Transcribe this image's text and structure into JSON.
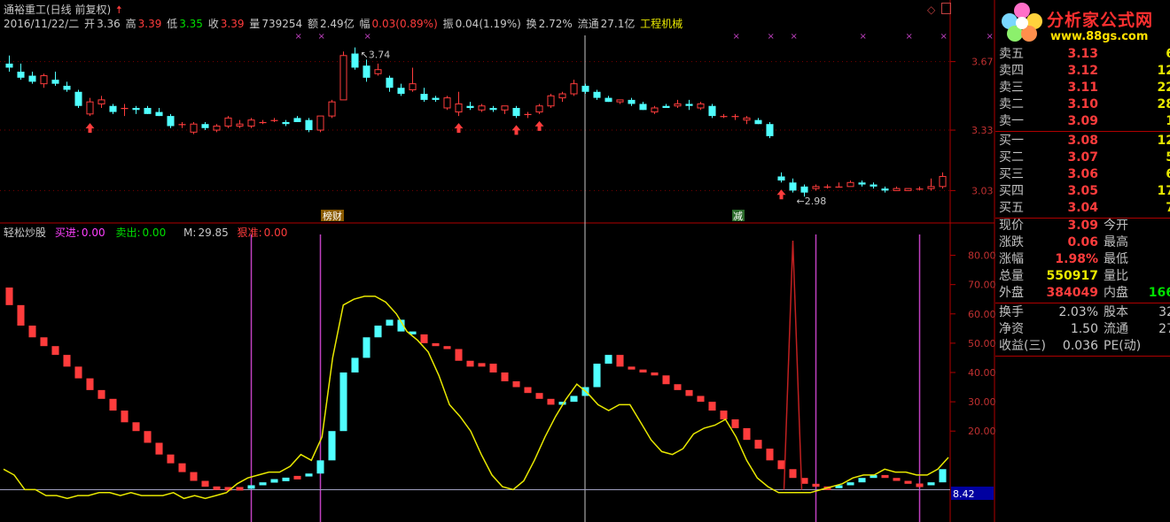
{
  "header": {
    "title": "通裕重工(日线 前复权)",
    "date": "2016/11/22/二",
    "open_label": "开",
    "open": "3.36",
    "high_label": "高",
    "high": "3.39",
    "low_label": "低",
    "low": "3.35",
    "close_label": "收",
    "close": "3.39",
    "volume_label": "量",
    "volume": "739254",
    "amount_label": "额",
    "amount": "2.49亿",
    "range_label": "幅",
    "range": "0.03(0.89%)",
    "amplitude_label": "振",
    "amplitude": "0.04(1.19%)",
    "turnover_label": "换",
    "turnover": "2.72%",
    "float_label": "流通",
    "float": "27.1亿",
    "sector": "工程机械"
  },
  "indicator": {
    "name": "轻松炒股",
    "buy_label": "买进:",
    "buy": "0.00",
    "sell_label": "卖出:",
    "sell": "0.00",
    "m_label": "M:",
    "m": "29.85",
    "hard_label": "狠准:",
    "hard": "0.00"
  },
  "annotations": {
    "high_mark": "3.74",
    "low_mark": "2.98",
    "tag1": "榜财",
    "tag2": "减",
    "cursor_value": "8.42"
  },
  "price_axis": [
    "3.67",
    "3.33",
    "3.03"
  ],
  "indicator_axis": [
    "80.00",
    "70.00",
    "60.00",
    "50.00",
    "40.00",
    "30.00",
    "20.00"
  ],
  "logo": {
    "text": "分析家公式网",
    "url": "www.88gs.com"
  },
  "orderbook": {
    "sells": [
      {
        "label": "卖五",
        "price": "3.13",
        "vol": "6"
      },
      {
        "label": "卖四",
        "price": "3.12",
        "vol": "12"
      },
      {
        "label": "卖三",
        "price": "3.11",
        "vol": "22"
      },
      {
        "label": "卖二",
        "price": "3.10",
        "vol": "28"
      },
      {
        "label": "卖一",
        "price": "3.09",
        "vol": "1"
      }
    ],
    "buys": [
      {
        "label": "买一",
        "price": "3.08",
        "vol": "12"
      },
      {
        "label": "买二",
        "price": "3.07",
        "vol": "5"
      },
      {
        "label": "买三",
        "price": "3.06",
        "vol": "6"
      },
      {
        "label": "买四",
        "price": "3.05",
        "vol": "17"
      },
      {
        "label": "买五",
        "price": "3.04",
        "vol": "7"
      }
    ]
  },
  "quote": {
    "price_label": "现价",
    "price": "3.09",
    "open_label": "今开",
    "change_label": "涨跌",
    "change": "0.06",
    "high_label": "最高",
    "pct_label": "涨幅",
    "pct": "1.98%",
    "low_label": "最低",
    "total_label": "总量",
    "total": "550917",
    "ratio_label": "量比",
    "outer_label": "外盘",
    "outer": "384049",
    "inner_label": "内盘",
    "inner": "166"
  },
  "fundamentals": {
    "turnover_label": "换手",
    "turnover": "2.03%",
    "shares_label": "股本",
    "shares": "32",
    "netasset_label": "净资",
    "netasset": "1.50",
    "float_label": "流通",
    "float": "27",
    "eps_label": "收益(三)",
    "eps": "0.036",
    "pe_label": "PE(动)"
  },
  "colors": {
    "up": "#ff3c3c",
    "down": "#50ffff",
    "signal": "#e8e800",
    "grid": "#b00000",
    "vline": "#c040c0",
    "background": "#000000"
  },
  "chart_data": [
    {
      "type": "candlestick",
      "title": "通裕重工(日线 前复权)",
      "ylim": [
        2.9,
        3.8
      ],
      "candles": [
        [
          3.66,
          3.7,
          3.62,
          3.64
        ],
        [
          3.62,
          3.66,
          3.58,
          3.59
        ],
        [
          3.6,
          3.62,
          3.56,
          3.57
        ],
        [
          3.56,
          3.61,
          3.54,
          3.6
        ],
        [
          3.58,
          3.62,
          3.55,
          3.56
        ],
        [
          3.55,
          3.57,
          3.52,
          3.53
        ],
        [
          3.52,
          3.53,
          3.44,
          3.45
        ],
        [
          3.41,
          3.49,
          3.4,
          3.47
        ],
        [
          3.46,
          3.5,
          3.44,
          3.48
        ],
        [
          3.45,
          3.46,
          3.41,
          3.42
        ],
        [
          3.44,
          3.46,
          3.4,
          3.44
        ],
        [
          3.44,
          3.45,
          3.41,
          3.43
        ],
        [
          3.44,
          3.45,
          3.41,
          3.41
        ],
        [
          3.42,
          3.44,
          3.4,
          3.4
        ],
        [
          3.4,
          3.41,
          3.34,
          3.35
        ],
        [
          3.36,
          3.37,
          3.34,
          3.36
        ],
        [
          3.32,
          3.37,
          3.31,
          3.36
        ],
        [
          3.36,
          3.37,
          3.33,
          3.34
        ],
        [
          3.33,
          3.36,
          3.32,
          3.35
        ],
        [
          3.35,
          3.4,
          3.34,
          3.39
        ],
        [
          3.35,
          3.38,
          3.34,
          3.36
        ],
        [
          3.35,
          3.39,
          3.34,
          3.38
        ],
        [
          3.37,
          3.38,
          3.36,
          3.37
        ],
        [
          3.38,
          3.39,
          3.37,
          3.38
        ],
        [
          3.37,
          3.38,
          3.35,
          3.36
        ],
        [
          3.39,
          3.4,
          3.37,
          3.37
        ],
        [
          3.38,
          3.39,
          3.32,
          3.33
        ],
        [
          3.33,
          3.4,
          3.32,
          3.4
        ],
        [
          3.4,
          3.48,
          3.39,
          3.47
        ],
        [
          3.48,
          3.72,
          3.48,
          3.7
        ],
        [
          3.71,
          3.74,
          3.63,
          3.64
        ],
        [
          3.65,
          3.68,
          3.57,
          3.59
        ],
        [
          3.61,
          3.66,
          3.6,
          3.63
        ],
        [
          3.59,
          3.6,
          3.52,
          3.54
        ],
        [
          3.54,
          3.56,
          3.5,
          3.51
        ],
        [
          3.53,
          3.64,
          3.52,
          3.56
        ],
        [
          3.51,
          3.54,
          3.47,
          3.48
        ],
        [
          3.49,
          3.5,
          3.47,
          3.48
        ],
        [
          3.44,
          3.5,
          3.43,
          3.49
        ],
        [
          3.42,
          3.52,
          3.4,
          3.46
        ],
        [
          3.45,
          3.47,
          3.43,
          3.44
        ],
        [
          3.43,
          3.46,
          3.42,
          3.45
        ],
        [
          3.44,
          3.45,
          3.42,
          3.43
        ],
        [
          3.43,
          3.45,
          3.41,
          3.45
        ],
        [
          3.44,
          3.45,
          3.39,
          3.4
        ],
        [
          3.41,
          3.42,
          3.39,
          3.41
        ],
        [
          3.42,
          3.46,
          3.41,
          3.45
        ],
        [
          3.45,
          3.51,
          3.44,
          3.5
        ],
        [
          3.49,
          3.52,
          3.47,
          3.51
        ],
        [
          3.51,
          3.58,
          3.5,
          3.56
        ],
        [
          3.55,
          3.56,
          3.51,
          3.52
        ],
        [
          3.52,
          3.53,
          3.48,
          3.49
        ],
        [
          3.49,
          3.5,
          3.47,
          3.47
        ],
        [
          3.47,
          3.48,
          3.46,
          3.48
        ],
        [
          3.48,
          3.49,
          3.45,
          3.46
        ],
        [
          3.46,
          3.47,
          3.43,
          3.43
        ],
        [
          3.42,
          3.45,
          3.41,
          3.44
        ],
        [
          3.45,
          3.46,
          3.44,
          3.44
        ],
        [
          3.45,
          3.48,
          3.44,
          3.46
        ],
        [
          3.46,
          3.48,
          3.43,
          3.45
        ],
        [
          3.44,
          3.47,
          3.43,
          3.46
        ],
        [
          3.45,
          3.46,
          3.39,
          3.4
        ],
        [
          3.4,
          3.41,
          3.39,
          3.4
        ],
        [
          3.4,
          3.41,
          3.38,
          3.4
        ],
        [
          3.38,
          3.4,
          3.36,
          3.39
        ],
        [
          3.38,
          3.39,
          3.36,
          3.36
        ],
        [
          3.36,
          3.37,
          3.29,
          3.3
        ],
        [
          3.1,
          3.12,
          3.07,
          3.08
        ],
        [
          3.07,
          3.09,
          3.02,
          3.03
        ],
        [
          3.05,
          3.06,
          3.0,
          3.02
        ],
        [
          3.04,
          3.06,
          3.03,
          3.05
        ],
        [
          3.05,
          3.06,
          3.04,
          3.05
        ],
        [
          3.05,
          3.07,
          3.05,
          3.05
        ],
        [
          3.05,
          3.08,
          3.05,
          3.07
        ],
        [
          3.07,
          3.08,
          3.05,
          3.06
        ],
        [
          3.06,
          3.07,
          3.04,
          3.05
        ],
        [
          3.04,
          3.05,
          3.02,
          3.03
        ],
        [
          3.03,
          3.05,
          3.03,
          3.04
        ],
        [
          3.03,
          3.04,
          3.03,
          3.04
        ],
        [
          3.04,
          3.05,
          3.03,
          3.04
        ],
        [
          3.04,
          3.09,
          3.03,
          3.05
        ],
        [
          3.05,
          3.12,
          3.04,
          3.1
        ]
      ],
      "buy_arrows": [
        7,
        39,
        44,
        46,
        67
      ],
      "x_marks": [
        25,
        27,
        31,
        63,
        66,
        68,
        74,
        78,
        81,
        85
      ]
    },
    {
      "type": "bar+line",
      "title": "轻松炒股",
      "ylim": [
        -5,
        85
      ],
      "bars": [
        [
          63,
          "up"
        ],
        [
          56,
          "up"
        ],
        [
          52,
          "up"
        ],
        [
          49,
          "up"
        ],
        [
          46,
          "up"
        ],
        [
          42,
          "up"
        ],
        [
          38,
          "up"
        ],
        [
          34,
          "up"
        ],
        [
          31,
          "up"
        ],
        [
          27,
          "up"
        ],
        [
          23,
          "up"
        ],
        [
          20,
          "up"
        ],
        [
          16,
          "up"
        ],
        [
          12,
          "up"
        ],
        [
          9,
          "up"
        ],
        [
          6,
          "up"
        ],
        [
          3,
          "up"
        ],
        [
          1,
          "up"
        ],
        [
          0.5,
          "up"
        ],
        [
          0.3,
          "up"
        ],
        [
          0.3,
          "up"
        ],
        [
          1.5,
          "down"
        ],
        [
          2.5,
          "down"
        ],
        [
          3,
          "down"
        ],
        [
          3.5,
          "down"
        ],
        [
          4.5,
          "up"
        ],
        [
          5.5,
          "down"
        ],
        [
          10,
          "down"
        ],
        [
          20,
          "down"
        ],
        [
          40,
          "down"
        ],
        [
          45,
          "down"
        ],
        [
          52,
          "down"
        ],
        [
          56,
          "down"
        ],
        [
          58,
          "down"
        ],
        [
          54,
          "down"
        ],
        [
          53,
          "down"
        ],
        [
          50,
          "up"
        ],
        [
          49,
          "up"
        ],
        [
          48,
          "up"
        ],
        [
          44,
          "up"
        ],
        [
          42,
          "up"
        ],
        [
          43,
          "up"
        ],
        [
          40,
          "up"
        ],
        [
          37,
          "up"
        ],
        [
          35,
          "up"
        ],
        [
          33,
          "up"
        ],
        [
          31,
          "up"
        ],
        [
          29,
          "up"
        ],
        [
          30,
          "down"
        ],
        [
          32,
          "down"
        ],
        [
          35,
          "down"
        ],
        [
          43,
          "down"
        ],
        [
          46,
          "down"
        ],
        [
          42,
          "up"
        ],
        [
          41,
          "up"
        ],
        [
          40,
          "up"
        ],
        [
          39,
          "up"
        ],
        [
          36,
          "up"
        ],
        [
          34,
          "up"
        ],
        [
          32,
          "up"
        ],
        [
          30,
          "up"
        ],
        [
          27,
          "up"
        ],
        [
          24,
          "up"
        ],
        [
          21,
          "up"
        ],
        [
          17,
          "up"
        ],
        [
          14,
          "up"
        ],
        [
          10,
          "up"
        ],
        [
          7,
          "up"
        ],
        [
          4,
          "up"
        ],
        [
          2,
          "up"
        ],
        [
          1,
          "up"
        ],
        [
          0.5,
          "up"
        ],
        [
          1.5,
          "down"
        ],
        [
          2.5,
          "down"
        ],
        [
          4,
          "down"
        ],
        [
          5,
          "down"
        ],
        [
          4,
          "up"
        ],
        [
          3,
          "up"
        ],
        [
          2,
          "up"
        ],
        [
          1.5,
          "up"
        ],
        [
          2.5,
          "down"
        ],
        [
          7,
          "down"
        ]
      ],
      "line": [
        7,
        5,
        0,
        0,
        -2,
        -2,
        -3,
        -2,
        -2,
        -1,
        -1,
        -2,
        -1,
        -2,
        -2,
        -2,
        -1,
        -3,
        -2,
        -3,
        -2,
        -1,
        2,
        4,
        5,
        6,
        6,
        8,
        12,
        10,
        18,
        45,
        63,
        65,
        66,
        66,
        64,
        60,
        54,
        51,
        47,
        39,
        29,
        25,
        20,
        12,
        5,
        1,
        0,
        3,
        10,
        18,
        25,
        31,
        36,
        33,
        29,
        27,
        29,
        29,
        23,
        17,
        13,
        12,
        14,
        19,
        21,
        22,
        24,
        18,
        10,
        4,
        1,
        -1,
        -1,
        -1,
        -1,
        0,
        1,
        2,
        4,
        5,
        5,
        7,
        6,
        6,
        5,
        5,
        7,
        11
      ],
      "spike": {
        "index": 68,
        "value": 85
      },
      "vertical_lines": [
        21,
        27,
        70,
        79
      ]
    }
  ]
}
